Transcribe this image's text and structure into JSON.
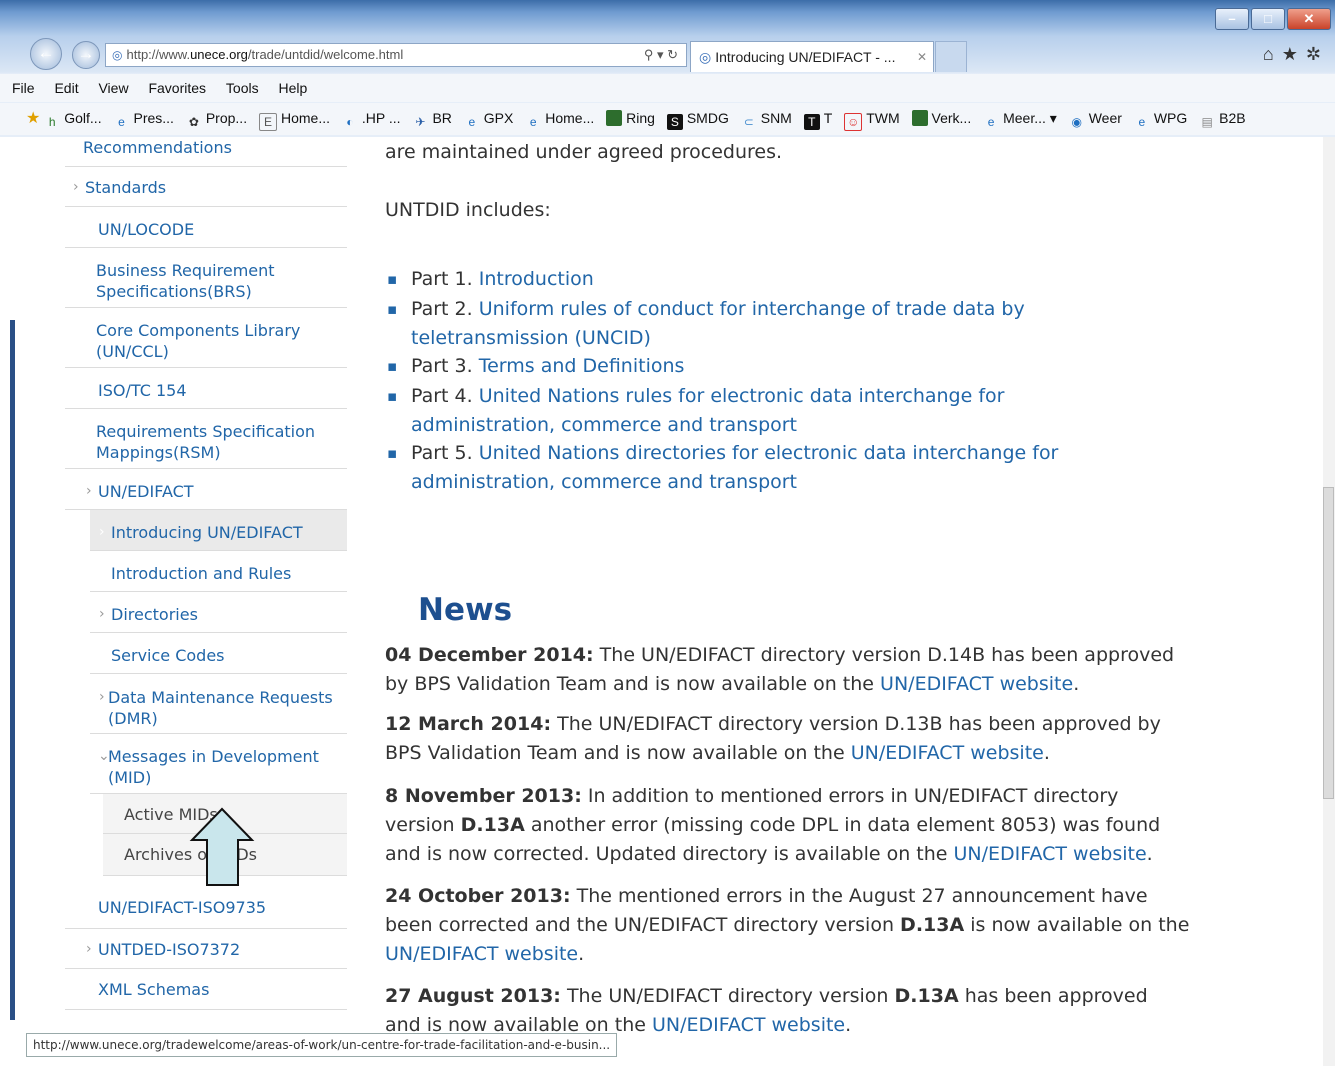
{
  "browser": {
    "url_prefix": "http://www.",
    "url_host": "unece.org",
    "url_path": "/trade/untdid/welcome.html",
    "tab_title": "Introducing UN/EDIFACT - ...",
    "menu": [
      "File",
      "Edit",
      "View",
      "Favorites",
      "Tools",
      "Help"
    ],
    "favorites": [
      "Golf...",
      "Pres...",
      "Prop...",
      "Home...",
      ".HP ...",
      "BR",
      "GPX",
      "Home...",
      "Ring",
      "SMDG",
      "SNM",
      "T",
      "TWM",
      "Verk...",
      "Meer...",
      "Weer",
      "WPG",
      "B2B"
    ],
    "status_url": "http://www.unece.org/tradewelcome/areas-of-work/un-centre-for-trade-facilitation-and-e-busin..."
  },
  "sidebar": {
    "items": [
      {
        "label": "Recommendations"
      },
      {
        "label": "Standards"
      },
      {
        "label": "UN/LOCODE"
      },
      {
        "label": "Business Requirement Specifications(BRS)"
      },
      {
        "label": "Core Components Library (UN/CCL)"
      },
      {
        "label": "ISO/TC 154"
      },
      {
        "label": "Requirements Specification Mappings(RSM)"
      },
      {
        "label": "UN/EDIFACT"
      },
      {
        "label": "Introducing UN/EDIFACT"
      },
      {
        "label": "Introduction and Rules"
      },
      {
        "label": "Directories"
      },
      {
        "label": "Service Codes"
      },
      {
        "label": "Data Maintenance Requests (DMR)"
      },
      {
        "label": "Messages in Development (MID)"
      },
      {
        "label": "Active MIDs"
      },
      {
        "label": "Archives of MIDs"
      },
      {
        "label": "UN/EDIFACT-ISO9735"
      },
      {
        "label": "UNTDED-ISO7372"
      },
      {
        "label": "XML Schemas"
      }
    ]
  },
  "main": {
    "line1": "are maintained under agreed procedures.",
    "includes": "UNTDID includes:",
    "parts": [
      {
        "prefix": "Part 1.",
        "link": "Introduction"
      },
      {
        "prefix": "Part 2.",
        "link": "Uniform rules of conduct for interchange of trade data by teletransmission (UNCID)"
      },
      {
        "prefix": "Part 3.",
        "link": "Terms and Definitions"
      },
      {
        "prefix": "Part 4.",
        "link": "United Nations rules for electronic data interchange for administration, commerce and transport"
      },
      {
        "prefix": "Part 5.",
        "link": "United Nations directories for electronic data interchange for administration, commerce and transport"
      }
    ],
    "news_title": "News",
    "news": [
      {
        "date": "04 December 2014:",
        "text": "The UN/EDIFACT directory version D.14B has been approved by BPS Validation Team and is now available on the",
        "link": "UN/EDIFACT website",
        "end": "."
      },
      {
        "date": "12 March 2014:",
        "text": "The UN/EDIFACT directory version D.13B has been approved by BPS Validation Team and is now available on the",
        "link": "UN/EDIFACT website",
        "end": "."
      },
      {
        "date": "8 November 2013:",
        "text_a": "In addition to mentioned errors in UN/EDIFACT directory version",
        "bold": "D.13A",
        "text_b": "another error (missing code DPL in data element 8053) was found and is now corrected. Updated directory is available on the",
        "link": "UN/EDIFACT website",
        "end": "."
      },
      {
        "date": "24 October 2013:",
        "text_a": "The mentioned errors in the August 27 announcement have been corrected and the UN/EDIFACT directory version",
        "bold": "D.13A",
        "text_b": "is now available on the",
        "link": "UN/EDIFACT website",
        "end": "."
      },
      {
        "date": "27 August 2013:",
        "text_a": "The UN/EDIFACT directory version",
        "bold": "D.13A",
        "text_b": "has been approved and is now available on the",
        "link": "UN/EDIFACT website",
        "end": "."
      }
    ]
  }
}
